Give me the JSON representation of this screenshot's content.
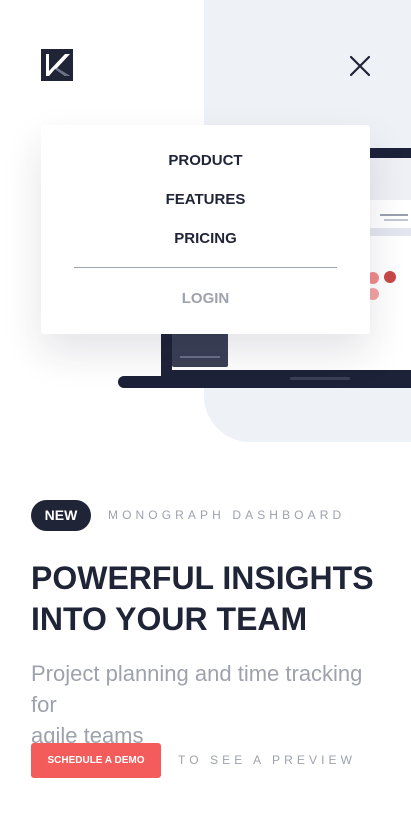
{
  "brand": {
    "logo_icon": "logo-k-icon"
  },
  "header": {
    "close_icon": "close-icon"
  },
  "menu": {
    "items": [
      {
        "label": "PRODUCT"
      },
      {
        "label": "FEATURES"
      },
      {
        "label": "PRICING"
      }
    ],
    "login_label": "LOGIN"
  },
  "hero": {
    "badge": "NEW",
    "eyebrow": "MONOGRAPH DASHBOARD",
    "headline_line1": "POWERFUL INSIGHTS",
    "headline_line2": "INTO YOUR TEAM",
    "subhead_line1": "Project planning and time tracking for",
    "subhead_line2": "agile teams",
    "cta_label": "SCHEDULE A DEMO",
    "cta_note": "TO SEE A PREVIEW"
  },
  "colors": {
    "primary_dark": "#1f2437",
    "accent": "#f45c5c",
    "muted_text": "#9ea2ad",
    "hero_background": "#eef1f6"
  }
}
